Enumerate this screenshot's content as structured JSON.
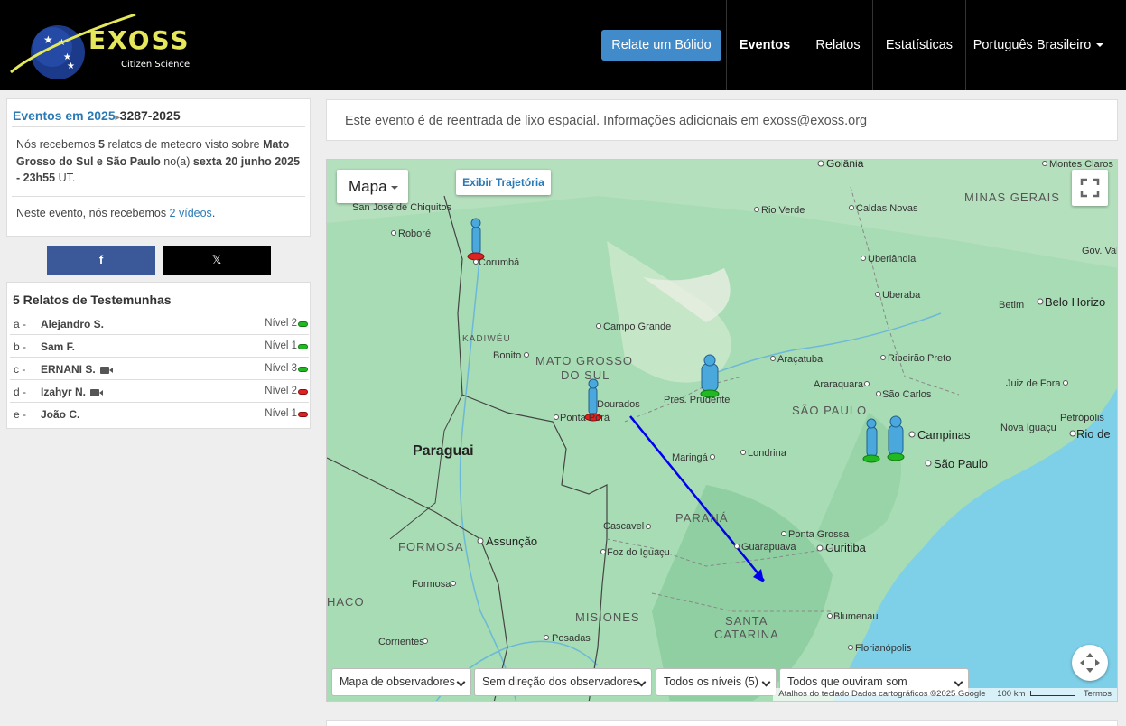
{
  "navbar": {
    "logo_text": "EXOSS",
    "logo_subtitle": "Citizen Science",
    "report_button": "Relate um Bólido",
    "items": [
      "Eventos",
      "Relatos",
      "Estatísticas"
    ],
    "language": "Português Brasileiro"
  },
  "event": {
    "title_year": "Eventos em 2025",
    "title_id": "3287-2025",
    "desc_part1": "Nós recebemos ",
    "report_count": "5",
    "desc_part2": " relatos de meteoro visto sobre ",
    "region": "Mato Grosso do Sul e São Paulo",
    "desc_part3": " no(a) ",
    "date": "sexta 20 junho 2025 - 23h55",
    "desc_part4": " UT.",
    "videos_part1": "Neste evento, nós recebemos ",
    "videos_link": "2 vídeos",
    "videos_part2": "."
  },
  "share": {
    "facebook": "f",
    "x": "𝕏"
  },
  "reports": {
    "title": "5 Relatos de Testemunhas",
    "rows": [
      {
        "letter": "a -",
        "name": "Alejandro  S.",
        "video": false,
        "level": "Nível 2",
        "status": "green"
      },
      {
        "letter": "b -",
        "name": "Sam  F.",
        "video": false,
        "level": "Nível 1",
        "status": "green"
      },
      {
        "letter": "c -",
        "name": "ERNANI  S.",
        "video": true,
        "level": "Nível 3",
        "status": "green"
      },
      {
        "letter": "d -",
        "name": "Izahyr  N.",
        "video": true,
        "level": "Nível 2",
        "status": "red"
      },
      {
        "letter": "e -",
        "name": "João  C.",
        "video": false,
        "level": "Nível 1",
        "status": "red"
      }
    ]
  },
  "notice": "Este evento é de reentrada de lixo espacial. Informações adicionais em exoss@exoss.org",
  "map": {
    "type_button": "Mapa",
    "trajectory_button": "Exibir Trajetória",
    "labels": {
      "goiania": "Goiânia",
      "montes_claros": "Montes Claros",
      "minas_gerais": "MINAS GERAIS",
      "san_jose": "San José de Chiquitos",
      "robore": "Roboré",
      "corumba": "Corumbá",
      "rio_verde": "Rio Verde",
      "caldas_novas": "Caldas Novas",
      "uberlandia": "Uberlândia",
      "gov_valadares": "Gov. Valadares",
      "uberaba": "Uberaba",
      "betim": "Betim",
      "belo_horizonte": "Belo Horizo",
      "campo_grande": "Campo Grande",
      "kadiweu": "KADIWÉU",
      "bonito": "Bonito",
      "mato_grosso": "MATO GROSSO",
      "do_sul": "DO SUL",
      "aracatuba": "Araçatuba",
      "ribeirao_preto": "Ribeirão Preto",
      "araraquara": "Araraquara",
      "sao_carlos": "São Carlos",
      "juiz_de_fora": "Juiz de Fora",
      "dourados": "Dourados",
      "ponta_pora": "Ponta Porã",
      "pres_prudente": "Pres. Prudente",
      "sao_paulo_state": "SÃO PAULO",
      "campinas": "Campinas",
      "nova_iguacu": "Nova Iguaçu",
      "petropolis": "Petrópolis",
      "rio_de_j": "Rio de",
      "paraguai": "Paraguai",
      "maringa": "Maringá",
      "londrina": "Londrina",
      "sao_paulo_city": "São Paulo",
      "cascavel": "Cascavel",
      "parana": "PARANÁ",
      "ponta_grossa": "Ponta Grossa",
      "formosa": "FORMOSA",
      "assuncao": "Assunção",
      "foz": "Foz do Iguaçu",
      "guarapuava": "Guarapuava",
      "curitiba": "Curitiba",
      "formosa_city": "Formosa",
      "chaco": "HACO",
      "misiones": "MISIONES",
      "santa": "SANTA",
      "catarina": "CATARINA",
      "blumenau": "Blumenau",
      "corrientes": "Corrientes",
      "posadas": "Posadas",
      "florianopolis": "Florianópolis"
    },
    "filters": [
      "Mapa de observadores",
      "Sem direção dos observadores",
      "Todos os níveis (5)",
      "Todos que ouviram som"
    ],
    "footer_attrib": "Atalhos do teclado  Dados cartográficos ©2025 Google",
    "footer_scale": "100 km",
    "footer_terms": "Termos",
    "colors": {
      "trajectory": "#0000ee",
      "ocean": "#7ecfe8",
      "land": "#a8dcb4"
    }
  }
}
